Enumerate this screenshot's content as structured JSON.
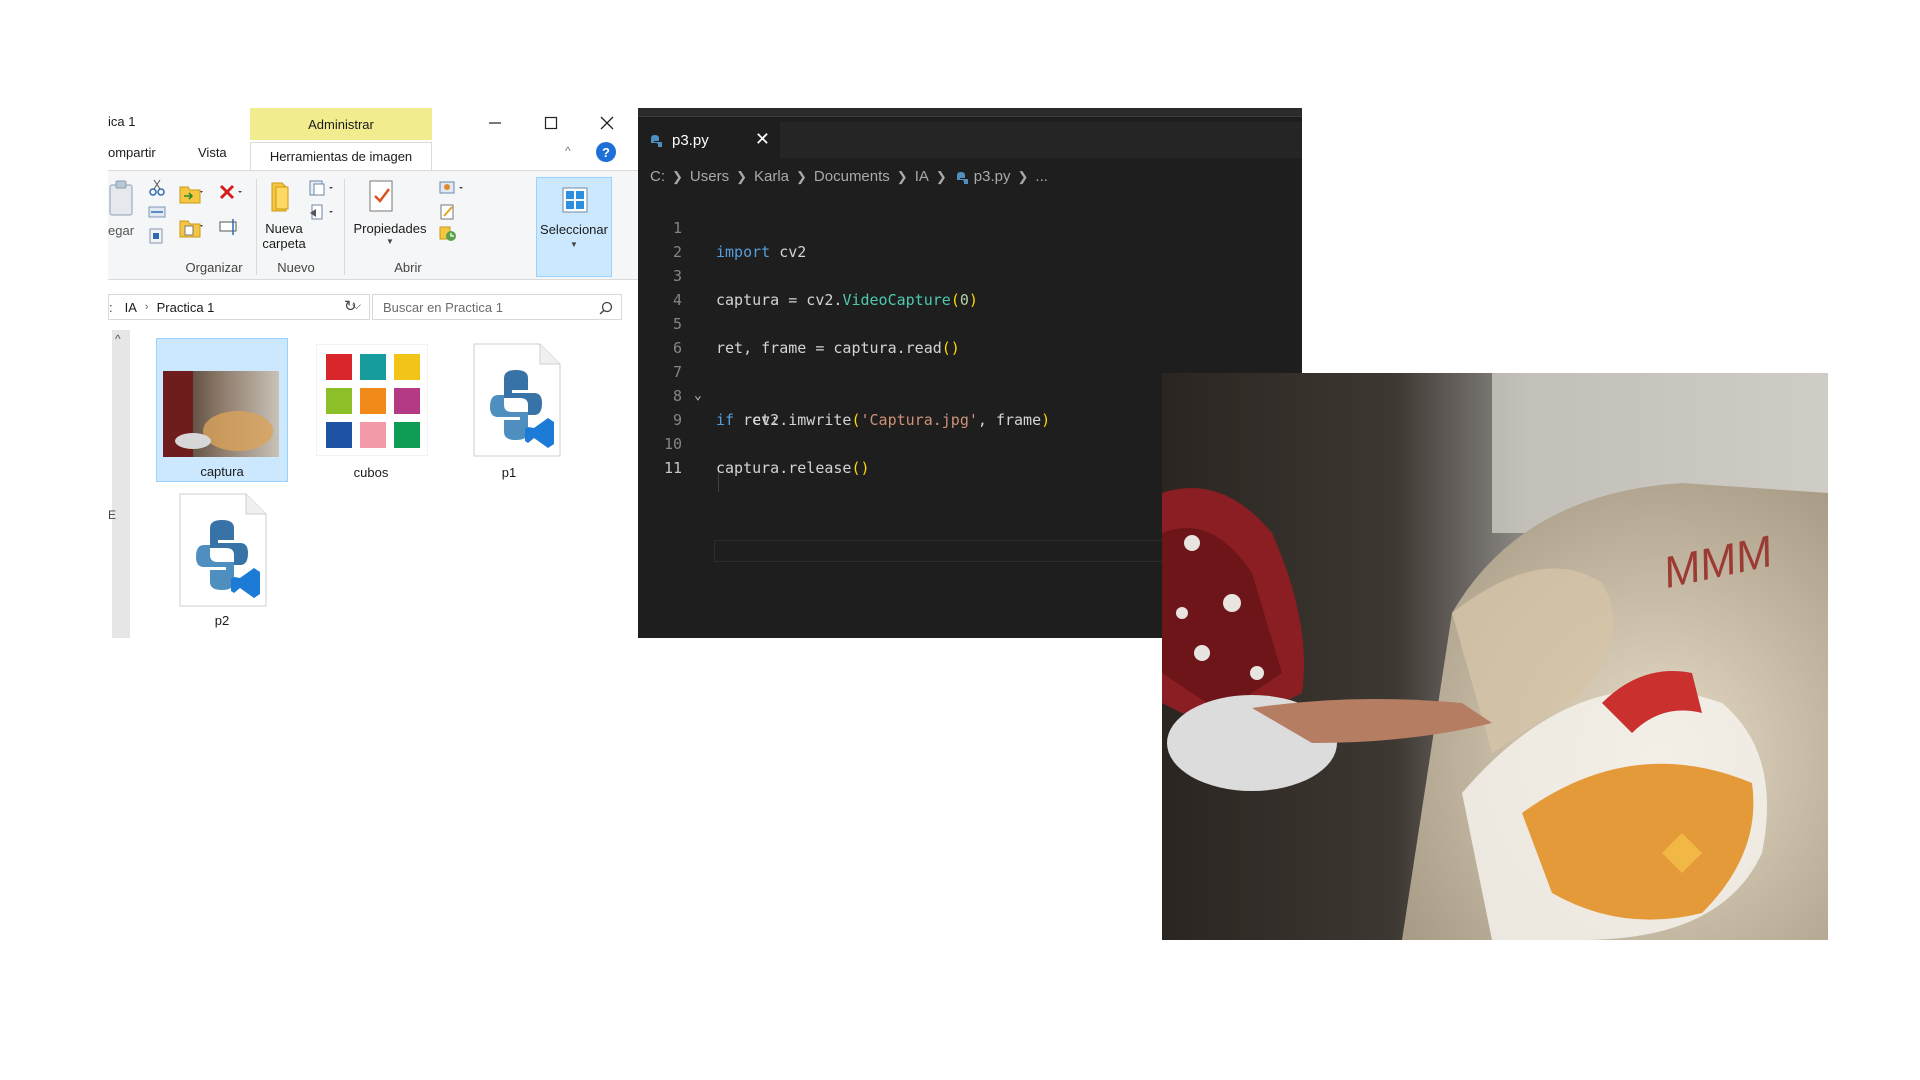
{
  "explorer": {
    "title": "ica 1",
    "context_tab": "Administrar",
    "ribbon_tabs": [
      "ompartir",
      "Vista"
    ],
    "active_tab": "Herramientas de imagen",
    "ribbon": {
      "paste_label": "egar",
      "new_folder_label": "Nueva\ncarpeta",
      "properties_label": "Propiedades",
      "select_label": "Seleccionar",
      "groups": [
        "Organizar",
        "Nuevo",
        "Abrir"
      ]
    },
    "address": {
      "prefix": ":",
      "segments": [
        "IA",
        "Practica 1"
      ]
    },
    "search": {
      "placeholder": "Buscar en Practica 1"
    },
    "files": [
      {
        "name": "captura",
        "type": "image",
        "selected": true
      },
      {
        "name": "cubos",
        "type": "image",
        "selected": false
      },
      {
        "name": "p1",
        "type": "python",
        "selected": false
      },
      {
        "name": "p2",
        "type": "python",
        "selected": false
      }
    ],
    "nav_fragment": "E"
  },
  "vscode": {
    "tab": {
      "label": "p3.py",
      "close": "✕"
    },
    "breadcrumb": [
      "C:",
      "Users",
      "Karla",
      "Documents",
      "IA",
      "p3.py",
      "..."
    ],
    "lines": [
      {
        "n": "1",
        "text": "import cv2"
      },
      {
        "n": "2",
        "text": ""
      },
      {
        "n": "3",
        "text": "captura = cv2.VideoCapture(0)"
      },
      {
        "n": "4",
        "text": ""
      },
      {
        "n": "5",
        "text": "ret, frame = captura.read()"
      },
      {
        "n": "6",
        "text": ""
      },
      {
        "n": "7",
        "text": "if ret:"
      },
      {
        "n": "8",
        "text": "    cv2.imwrite('Captura.jpg', frame)"
      },
      {
        "n": "9",
        "text": ""
      },
      {
        "n": "10",
        "text": "captura.release()"
      },
      {
        "n": "11",
        "text": ""
      }
    ]
  },
  "photo": {
    "caption_text": "MMM"
  },
  "colors": {
    "admin_tab": "#f1ed8f",
    "selection": "#cce8ff",
    "editor_bg": "#1e1e1e",
    "keyword": "#569cd6",
    "class_name": "#4ec9b0",
    "string": "#ce9178",
    "number": "#b5cea8",
    "bracket": "#ffd700"
  }
}
